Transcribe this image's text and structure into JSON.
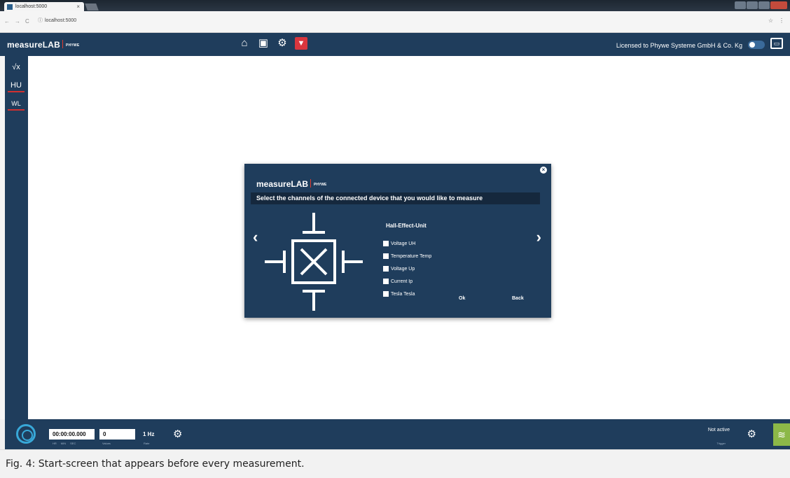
{
  "browser": {
    "tab_title": "localhost:5000",
    "tab_close": "×",
    "url": "localhost:5000",
    "back": "←",
    "forward": "→",
    "reload": "C",
    "info": "ⓘ",
    "star": "☆",
    "menu": "⋮"
  },
  "header": {
    "logo": "measureLAB",
    "brand": "PHYWE",
    "license": "Licensed to Phywe Systeme GmbH & Co. Kg",
    "icons": [
      "home-icon",
      "save-icon",
      "settings-icon",
      "export-icon"
    ]
  },
  "sidebar": {
    "items": [
      {
        "label": "√x",
        "icon": "formula-icon"
      },
      {
        "label": "HU",
        "icon": "hall-unit-icon"
      },
      {
        "label": "WL",
        "icon": "device-icon"
      }
    ]
  },
  "dialog": {
    "logo": "measureLAB",
    "brand": "PHYWE",
    "close": "×",
    "title": "Select the channels of the connected device that you would like to measure",
    "device_name": "Hall-Effect-Unit",
    "prev": "‹",
    "next": "›",
    "channels": [
      {
        "label": "Voltage UH",
        "checked": false
      },
      {
        "label": "Temperature Temp",
        "checked": false
      },
      {
        "label": "Voltage Up",
        "checked": false
      },
      {
        "label": "Current Ip",
        "checked": false
      },
      {
        "label": "Tesla Tesla",
        "checked": false
      }
    ],
    "ok_label": "Ok",
    "back_label": "Back"
  },
  "bottombar": {
    "time": "00:00:00.000",
    "time_units": [
      "HR",
      "MIN",
      "SEC"
    ],
    "values": "0",
    "values_label": "Values",
    "rate": "1 Hz",
    "rate_label": "Rate",
    "trigger_status": "Not active",
    "trigger_label": "Trigger"
  },
  "caption": "Fig. 4: Start-screen that appears before every measurement.",
  "colors": {
    "header": "#1f3d5c",
    "accent_red": "#d9363e",
    "record": "#38a8d8",
    "layers": "#8cb848"
  }
}
